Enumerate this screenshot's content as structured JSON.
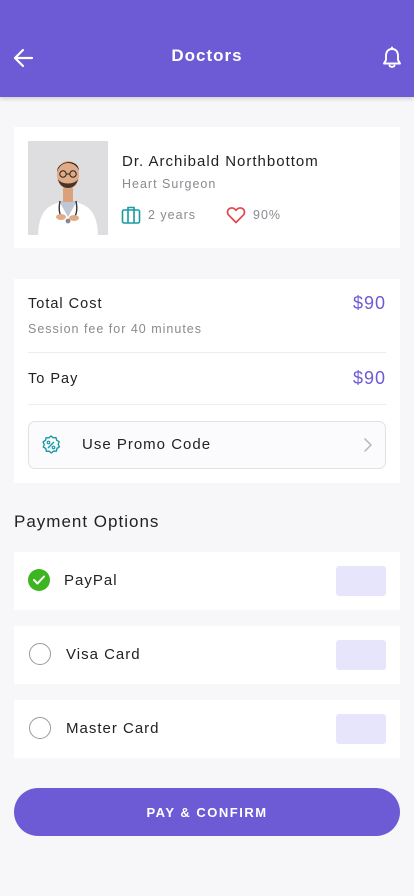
{
  "header": {
    "title": "Doctors",
    "back_icon": "arrow-left-icon",
    "bell_icon": "bell-icon",
    "color": "#6c5bd4"
  },
  "doctor": {
    "name": "Dr. Archibald Northbottom",
    "specialty": "Heart Surgeon",
    "experience": "2 years",
    "rating": "90%",
    "experience_icon": "briefcase-icon",
    "rating_icon": "heart-icon"
  },
  "cost": {
    "total_label": "Total Cost",
    "total_value": "$90",
    "session_note": "Session fee for 40 minutes",
    "to_pay_label": "To Pay",
    "to_pay_value": "$90",
    "promo_label": "Use Promo Code",
    "promo_icon": "percent-badge-icon"
  },
  "payment": {
    "section_title": "Payment Options",
    "options": [
      {
        "label": "PayPal",
        "selected": true
      },
      {
        "label": "Visa Card",
        "selected": false
      },
      {
        "label": "Master Card",
        "selected": false
      }
    ]
  },
  "actions": {
    "pay_confirm_label": "PAY & CONFIRM"
  },
  "colors": {
    "accent": "#6c5bd4",
    "teal": "#1a9aa3",
    "heart": "#e0474c",
    "selected": "#3cb521"
  }
}
